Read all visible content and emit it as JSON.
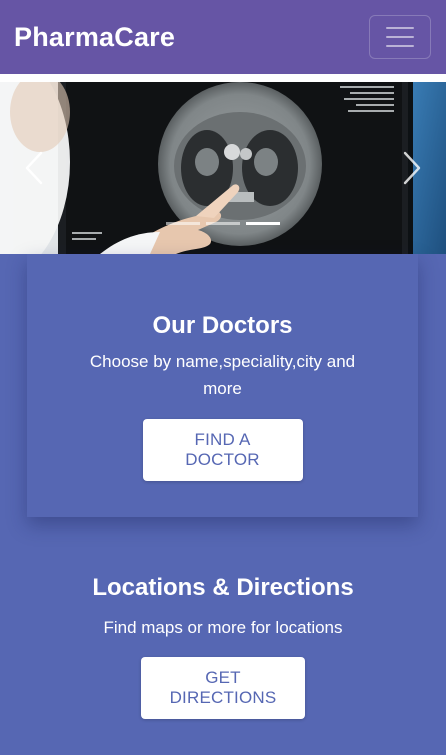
{
  "navbar": {
    "brand": "PharmaCare",
    "menu_icon": "hamburger-menu-icon"
  },
  "carousel": {
    "image": "doctor-pointing-at-ct-scan-monitor",
    "prev_icon": "chevron-left-icon",
    "next_icon": "chevron-right-icon",
    "slide_count": 3,
    "active_slide": 2
  },
  "doctors": {
    "title": "Our Doctors",
    "subtitle": "Choose by name,speciality,city and more",
    "button": "FIND A DOCTOR"
  },
  "locations": {
    "title": "Locations & Directions",
    "subtitle": "Find maps or more for locations",
    "button": "GET DIRECTIONS"
  },
  "colors": {
    "navbar": "#6655a5",
    "background": "#5667b3",
    "button_bg": "#ffffff",
    "button_text": "#5667b3"
  }
}
